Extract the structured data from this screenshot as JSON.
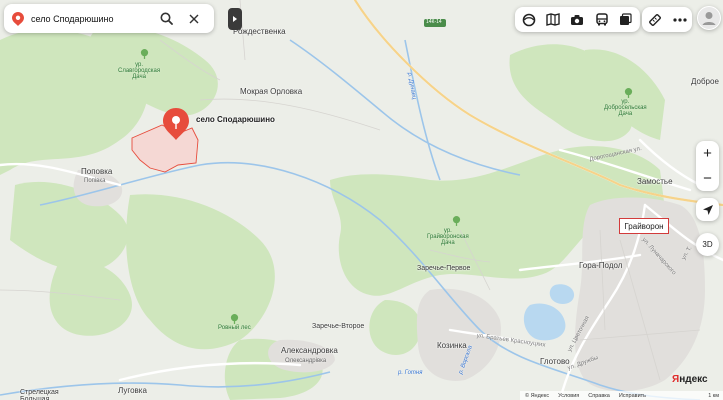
{
  "search": {
    "query": "село Сподарюшино"
  },
  "place_marker": {
    "label": "село Сподарюшино"
  },
  "labels": {
    "rozhdestvenka": "Рождественка",
    "mokraya_orlovka": "Мокрая Орловка",
    "slavgorodskaya": "ур.\nСлавгородская\nДача",
    "popovka": "Поповка",
    "popovka_ua": "Попівка",
    "dobroe": "Доброе",
    "dobroslavskaya": "ур.\nДобросельская\nДача",
    "zamostye": "Замостье",
    "graivoron": "Грайворон",
    "graivoronskaya": "ур.\nГрайворонская\nДача",
    "zarechye_pervoe": "Заречье-Первое",
    "gora_podol": "Гора-Подол",
    "rovny_les": "Ровный лес",
    "zarechye_vtoroe": "Заречье-Второе",
    "aleksandrovka": "Александровка",
    "aleksandrovka_ua": "Олександрівка",
    "kozinka": "Козинка",
    "glotovo": "Глотово",
    "streletskaya": "Стрелецкая\nБольшая",
    "lugovka": "Луговка",
    "road_14k14": "14К-14",
    "river_dunayets": "р. Дунаец",
    "river_gotnya": "р. Готня",
    "river_vorskla": "р. Ворскла",
    "street_dorogoshchanskaya": "Дорогощанская ул.",
    "street_lunacharskogo": "ул. Луначарского",
    "street_tr": "ул. Т.",
    "street_bratyev": "ул. Братьев Красноуцких",
    "street_druzhby": "ул. Дружбы",
    "street_tsvetochnaya": "ул. Цветочная"
  },
  "toolbar": {
    "icons": [
      "panorama-icon",
      "map-book-icon",
      "camera-icon",
      "bus-icon",
      "layers-icon"
    ],
    "tools": [
      "ruler-icon",
      "more-icon"
    ]
  },
  "controls": {
    "zoom_in": "+",
    "zoom_out": "−",
    "three_d": "3D"
  },
  "footer": {
    "links": [
      "© Яндекс",
      "Условия",
      "Справка",
      "Исправить"
    ],
    "scale": "1 км"
  },
  "logo": {
    "y": "Я",
    "rest": "ндекс"
  },
  "colors": {
    "accent": "#e74c3c",
    "forest": "#cfe6bd",
    "water": "#b8d8f0",
    "boundary": "#e74c3c"
  }
}
